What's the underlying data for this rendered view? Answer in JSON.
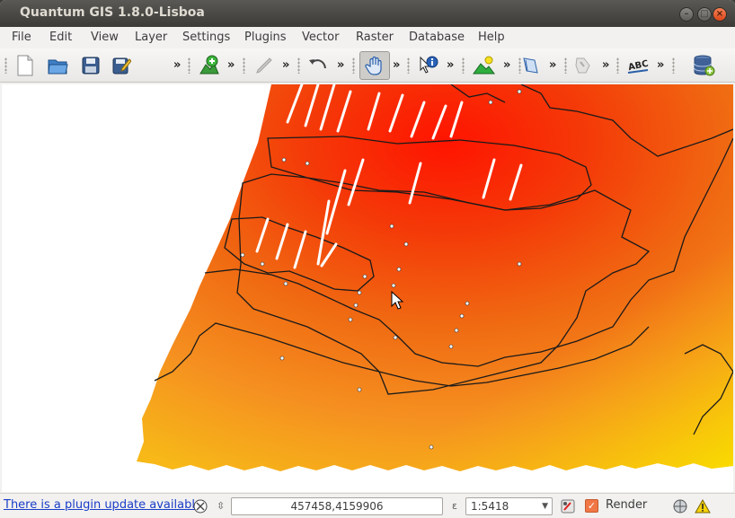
{
  "window": {
    "title": "Quantum GIS 1.8.0-Lisboa",
    "controls": {
      "minimize": "–",
      "maximize": "□",
      "close": "×"
    }
  },
  "menubar": {
    "items": [
      {
        "label": "File"
      },
      {
        "label": "Edit"
      },
      {
        "label": "View"
      },
      {
        "label": "Layer"
      },
      {
        "label": "Settings"
      },
      {
        "label": "Plugins"
      },
      {
        "label": "Vector"
      },
      {
        "label": "Raster"
      },
      {
        "label": "Database"
      },
      {
        "label": "Help"
      }
    ]
  },
  "toolbar": {
    "overflow_glyph": "»",
    "buttons": [
      {
        "icon": "new-project-icon"
      },
      {
        "icon": "open-project-icon"
      },
      {
        "icon": "save-project-icon"
      },
      {
        "icon": "save-as-icon"
      },
      {
        "icon": "add-vector-layer-icon"
      },
      {
        "icon": "pencil-edit-icon"
      },
      {
        "icon": "undo-icon"
      },
      {
        "icon": "pan-hand-icon",
        "active": true
      },
      {
        "icon": "identify-icon"
      },
      {
        "icon": "raster-terrain-icon"
      },
      {
        "icon": "bookmark-icon"
      },
      {
        "icon": "digitize-icon"
      },
      {
        "icon": "label-abc-icon",
        "text": "ABC"
      },
      {
        "icon": "database-icon"
      }
    ]
  },
  "map": {
    "colors": {
      "high": "#ff1a00",
      "mid": "#f05a10",
      "low": "#f7a020",
      "edge": "#f9d000",
      "outline": "#1a1a1a"
    }
  },
  "statusbar": {
    "plugin_update_text": "There is a plugin update available",
    "coord_label": "⇳",
    "coordinates": "457458,4159906",
    "scale_label": "ε",
    "scale": "1:5418",
    "render_label": "Render",
    "render_checked": true,
    "dropdown_glyph": "▼"
  }
}
